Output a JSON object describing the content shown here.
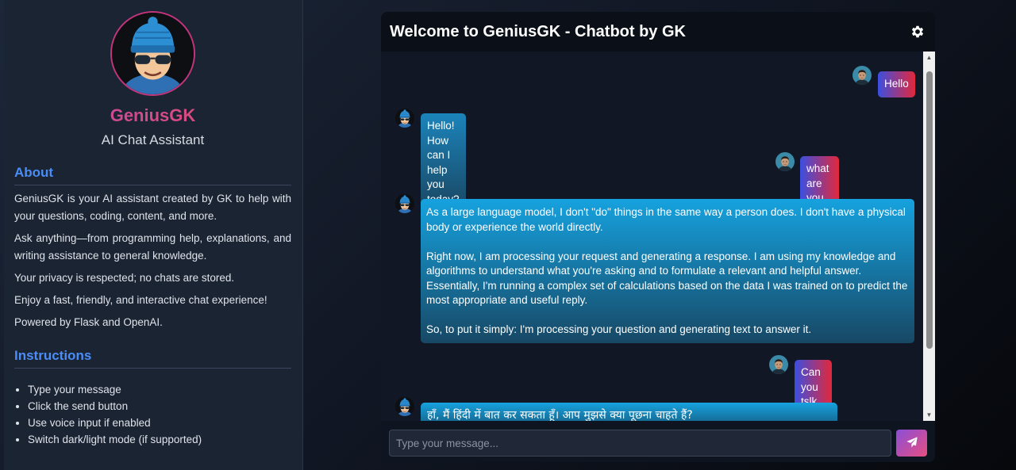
{
  "sidebar": {
    "brand": "GeniusGK",
    "subtitle": "AI Chat Assistant",
    "about_title": "About",
    "about": [
      "GeniusGK is your AI assistant created by GK to help with your questions, coding, content, and more.",
      "Ask anything—from programming help, explanations, and writing assistance to general knowledge.",
      "Your privacy is respected; no chats are stored.",
      "Enjoy a fast, friendly, and interactive chat experience!",
      "Powered by Flask and OpenAI."
    ],
    "instructions_title": "Instructions",
    "instructions": [
      "Type your message",
      "Click the send button",
      "Use voice input if enabled",
      "Switch dark/light mode (if supported)"
    ]
  },
  "chat": {
    "title": "Welcome to GeniusGK - Chatbot by GK",
    "messages": [
      {
        "sender": "user",
        "text": "Hello"
      },
      {
        "sender": "bot",
        "text": "Hello! How can I help you today?"
      },
      {
        "sender": "user",
        "text": "what are you doing ?"
      },
      {
        "sender": "bot",
        "paragraphs": [
          "As a large language model, I don't \"do\" things in the same way a person does. I don't have a physical body or experience the world directly.",
          "Right now, I am processing your request and generating a response. I am using my knowledge and algorithms to understand what you're asking and to formulate a relevant and helpful answer. Essentially, I'm running a complex set of calculations based on the data I was trained on to predict the most appropriate and useful reply.",
          "So, to put it simply: I'm processing your question and generating text to answer it."
        ]
      },
      {
        "sender": "user",
        "text": "Can you tslk in Hindi ?"
      },
      {
        "sender": "bot",
        "text": "हाँ, मैं हिंदी में बात कर सकता हूँ। आप मुझसे क्या पूछना चाहते हैं?"
      }
    ],
    "input": {
      "placeholder": "Type your message...",
      "value": ""
    }
  },
  "icons": {
    "settings": "gear-icon",
    "send": "paper-plane-icon",
    "bot_avatar": "cartoon-beanie-avatar",
    "user_avatar": "user-photo-avatar"
  },
  "colors": {
    "accent_blue": "#4a8df7",
    "brand_pink": "#c2357c",
    "user_bubble_start": "#3c4fe0",
    "user_bubble_end": "#e2283c",
    "bot_bubble": "#16a2df"
  }
}
